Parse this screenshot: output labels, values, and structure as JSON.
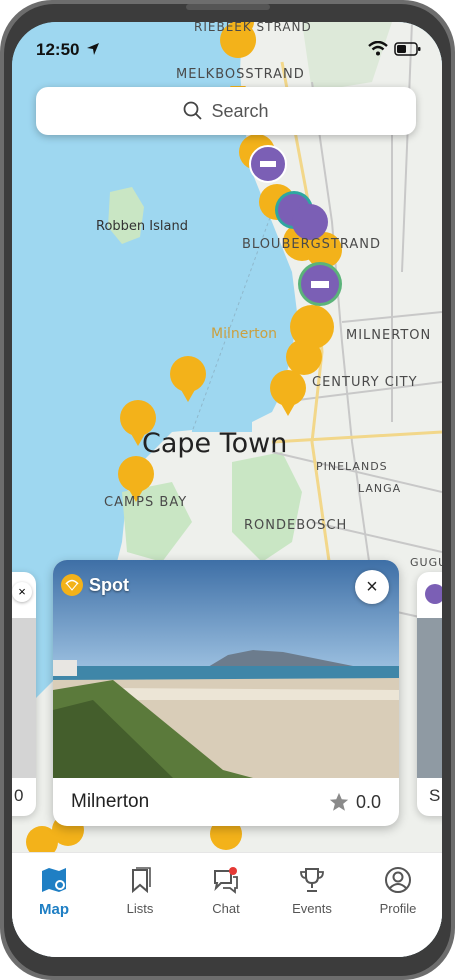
{
  "status": {
    "time": "12:50"
  },
  "search": {
    "placeholder": "Search"
  },
  "map_labels": {
    "riebeek_strand": "RIEBEEK STRAND",
    "melkbosstrand": "MELKBOSSTRAND",
    "robben_island": "Robben Island",
    "bloubergstrand": "BLOUBERGSTRAND",
    "milnerton_gold": "Milnerton",
    "milnerton": "MILNERTON",
    "century_city": "CENTURY CITY",
    "cape_town": "Cape Town",
    "camps_bay": "CAMPS BAY",
    "pinelands": "PINELANDS",
    "langa": "LANGA",
    "rondebosch": "RONDEBOSCH",
    "gugulethu": "GUGU"
  },
  "card": {
    "badge": "Spot",
    "close": "×",
    "title": "Milnerton",
    "rating": "0.0"
  },
  "side_cards": {
    "left_value": "0",
    "right_letter": "S"
  },
  "tabs": [
    {
      "label": "Map",
      "icon": "map-icon"
    },
    {
      "label": "Lists",
      "icon": "bookmark-icon"
    },
    {
      "label": "Chat",
      "icon": "chat-icon"
    },
    {
      "label": "Events",
      "icon": "trophy-icon"
    },
    {
      "label": "Profile",
      "icon": "profile-icon"
    }
  ],
  "colors": {
    "accent": "#1f7fc4",
    "spot_pin": "#f3b21a",
    "stay_pin": "#7b5fb5",
    "water": "#9ed7f0",
    "land": "#eef0ec"
  }
}
